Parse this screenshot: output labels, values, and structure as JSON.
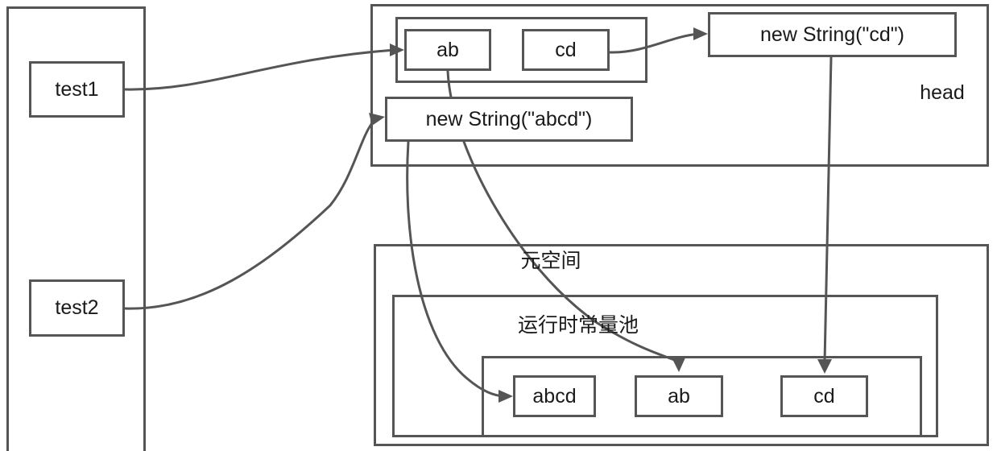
{
  "diagram": {
    "title": "JVM String memory layout",
    "stroke_color": "#555555",
    "text_color": "#1a1a1a",
    "background": "#ffffff"
  },
  "stack": {
    "label": "",
    "variables": [
      {
        "label": "test1"
      },
      {
        "label": "test2"
      }
    ]
  },
  "heap": {
    "label": "head",
    "char_array_group": {
      "items": [
        {
          "label": "ab"
        },
        {
          "label": "cd"
        }
      ]
    },
    "objects": [
      {
        "label": "new String(\"abcd\")"
      },
      {
        "label": "new String(\"cd\")"
      }
    ]
  },
  "metaspace": {
    "label": "元空间",
    "constant_pool": {
      "label": "运行时常量池",
      "entries": [
        {
          "label": "abcd"
        },
        {
          "label": "ab"
        },
        {
          "label": "cd"
        }
      ]
    }
  },
  "edges": [
    {
      "from": "test1",
      "to": "heap-ab"
    },
    {
      "from": "test2",
      "to": "new-string-abcd"
    },
    {
      "from": "heap-cd",
      "to": "new-string-cd"
    },
    {
      "from": "heap-ab",
      "to": "pool-ab"
    },
    {
      "from": "new-string-abcd",
      "to": "pool-abcd"
    },
    {
      "from": "new-string-cd",
      "to": "pool-cd"
    }
  ]
}
